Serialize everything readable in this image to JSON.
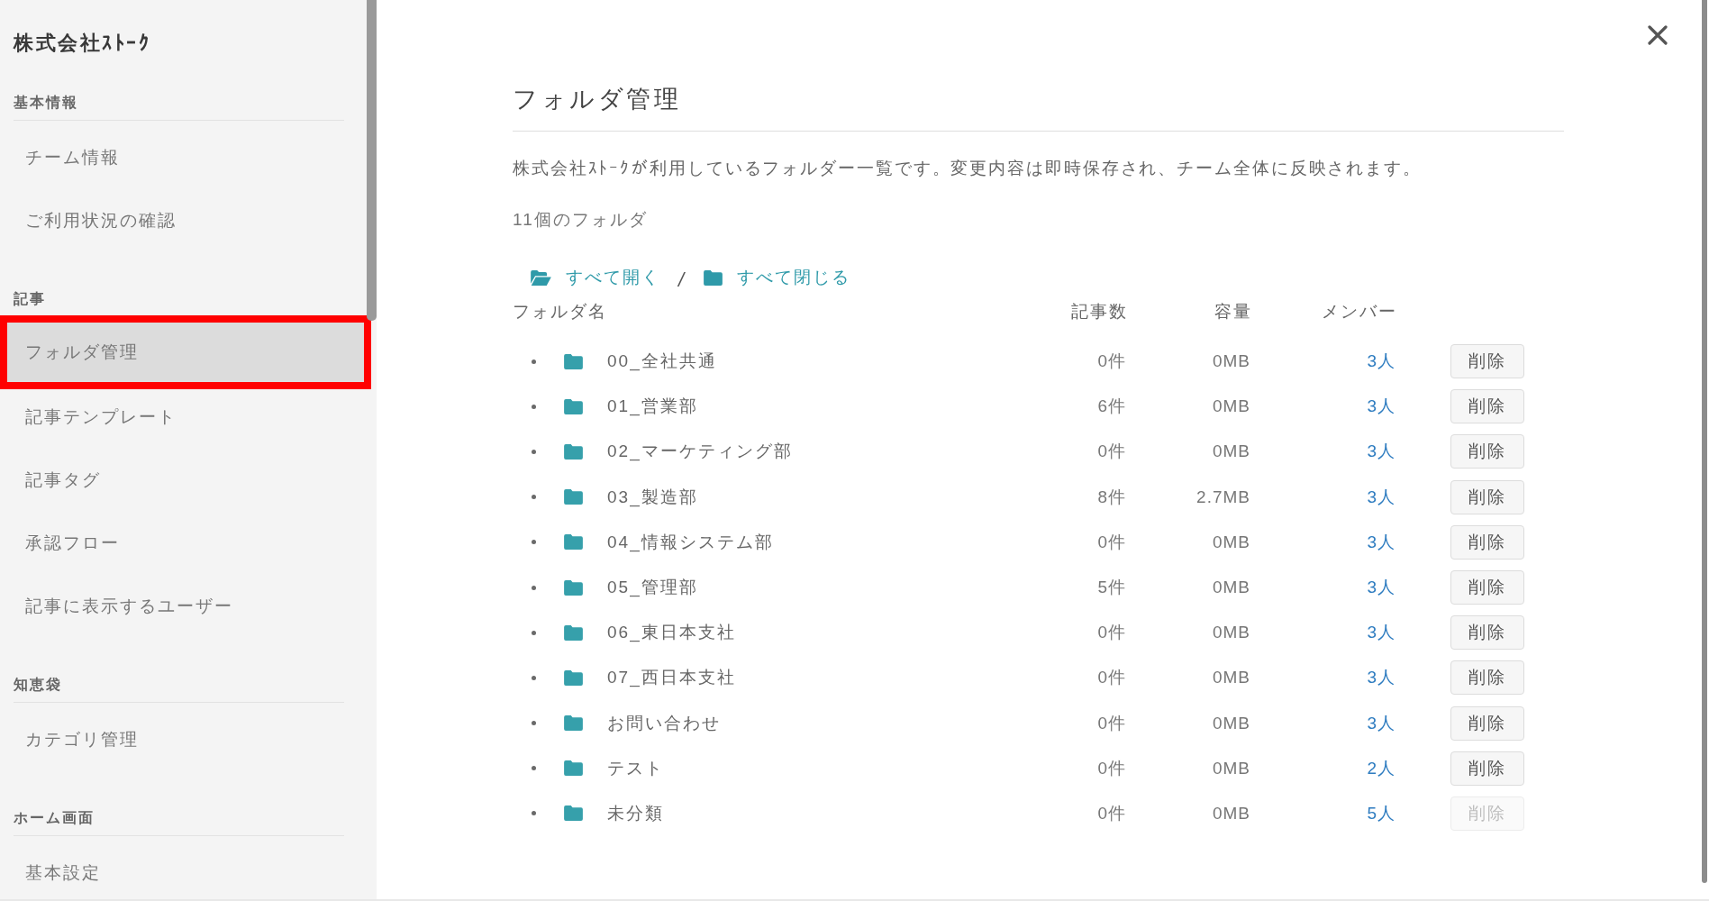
{
  "sidebar": {
    "company": "株式会社ｽﾄｰｸ",
    "sections": [
      {
        "title": "基本情報",
        "items": [
          {
            "label": "チーム情報",
            "selected": false,
            "highlighted": false
          },
          {
            "label": "ご利用状況の確認",
            "selected": false,
            "highlighted": false
          }
        ]
      },
      {
        "title": "記事",
        "items": [
          {
            "label": "フォルダ管理",
            "selected": true,
            "highlighted": true
          },
          {
            "label": "記事テンプレート",
            "selected": false,
            "highlighted": false
          },
          {
            "label": "記事タグ",
            "selected": false,
            "highlighted": false
          },
          {
            "label": "承認フロー",
            "selected": false,
            "highlighted": false
          },
          {
            "label": "記事に表示するユーザー",
            "selected": false,
            "highlighted": false
          }
        ]
      },
      {
        "title": "知恵袋",
        "items": [
          {
            "label": "カテゴリ管理",
            "selected": false,
            "highlighted": false
          }
        ]
      },
      {
        "title": "ホーム画面",
        "items": [
          {
            "label": "基本設定",
            "selected": false,
            "highlighted": false
          }
        ]
      }
    ]
  },
  "dialog": {
    "title": "フォルダ管理",
    "description": "株式会社ｽﾄｰｸが利用しているフォルダー一覧です。変更内容は即時保存され、チーム全体に反映されます。",
    "folder_count": "11個のフォルダ",
    "expand_all": "すべて開く",
    "separator": "/",
    "collapse_all": "すべて閉じる",
    "table": {
      "columns": [
        "フォルダ名",
        "記事数",
        "容量",
        "メンバー"
      ],
      "rows": [
        {
          "name": "00_全社共通",
          "articles": "0件",
          "size": "0MB",
          "members": "3人",
          "delete_label": "削除",
          "disabled": false
        },
        {
          "name": "01_営業部",
          "articles": "6件",
          "size": "0MB",
          "members": "3人",
          "delete_label": "削除",
          "disabled": false
        },
        {
          "name": "02_マーケティング部",
          "articles": "0件",
          "size": "0MB",
          "members": "3人",
          "delete_label": "削除",
          "disabled": false
        },
        {
          "name": "03_製造部",
          "articles": "8件",
          "size": "2.7MB",
          "members": "3人",
          "delete_label": "削除",
          "disabled": false
        },
        {
          "name": "04_情報システム部",
          "articles": "0件",
          "size": "0MB",
          "members": "3人",
          "delete_label": "削除",
          "disabled": false
        },
        {
          "name": "05_管理部",
          "articles": "5件",
          "size": "0MB",
          "members": "3人",
          "delete_label": "削除",
          "disabled": false
        },
        {
          "name": "06_東日本支社",
          "articles": "0件",
          "size": "0MB",
          "members": "3人",
          "delete_label": "削除",
          "disabled": false
        },
        {
          "name": "07_西日本支社",
          "articles": "0件",
          "size": "0MB",
          "members": "3人",
          "delete_label": "削除",
          "disabled": false
        },
        {
          "name": "お問い合わせ",
          "articles": "0件",
          "size": "0MB",
          "members": "3人",
          "delete_label": "削除",
          "disabled": false
        },
        {
          "name": "テスト",
          "articles": "0件",
          "size": "0MB",
          "members": "2人",
          "delete_label": "削除",
          "disabled": false
        },
        {
          "name": "未分類",
          "articles": "0件",
          "size": "0MB",
          "members": "5人",
          "delete_label": "削除",
          "disabled": true
        }
      ]
    }
  }
}
